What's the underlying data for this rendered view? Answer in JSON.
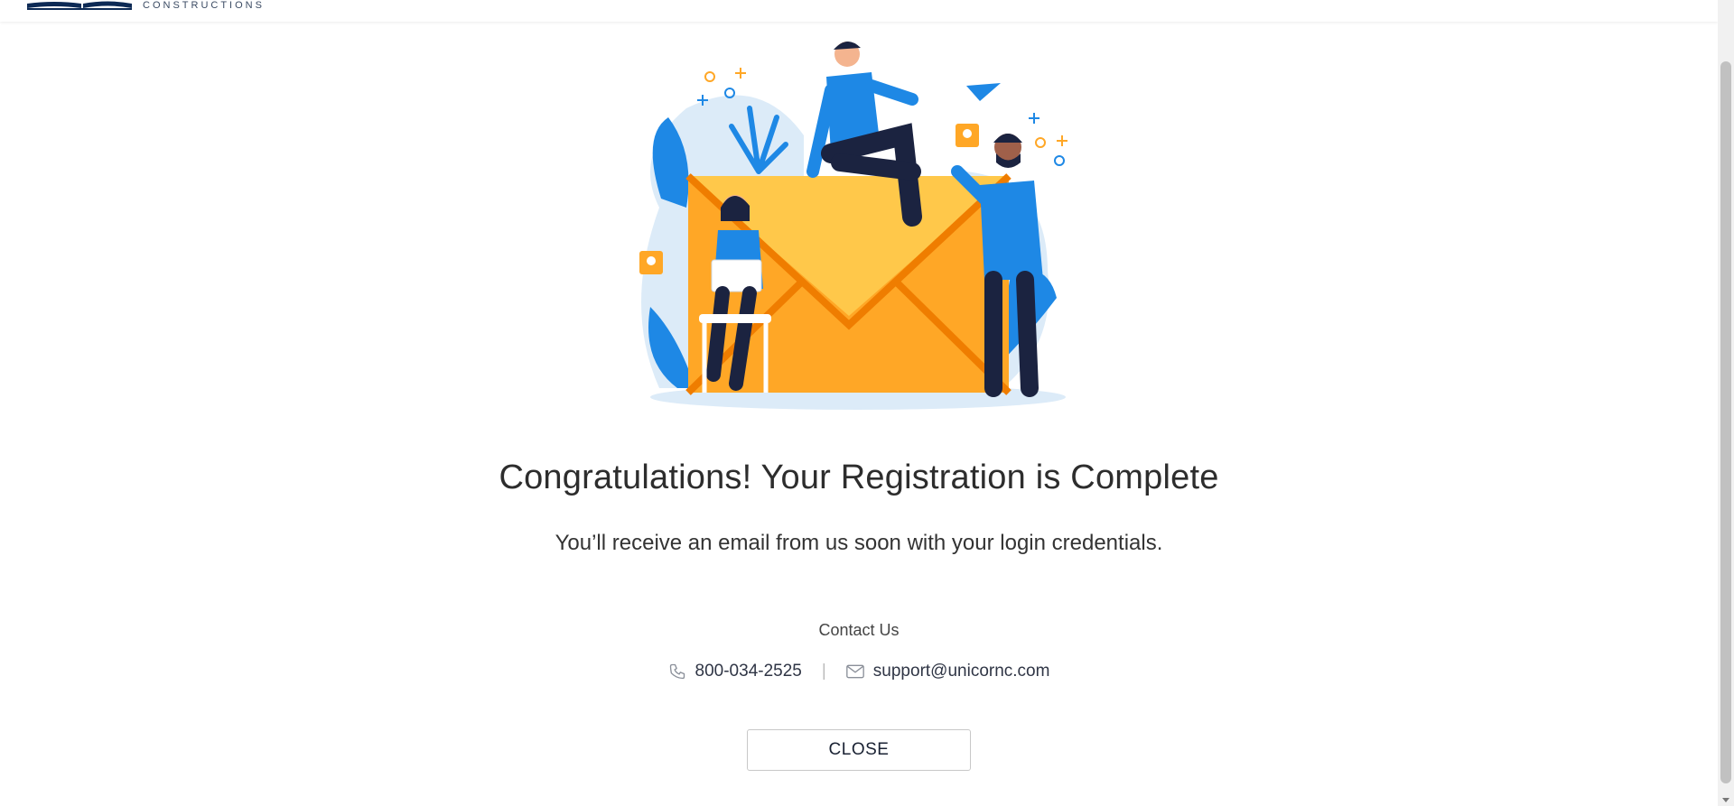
{
  "header": {
    "logo_text": "CONSTRUCTIONS"
  },
  "main": {
    "title": "Congratulations! Your Registration is Complete",
    "subtitle": "You’ll receive an email from us soon with your login credentials."
  },
  "contact": {
    "heading": "Contact Us",
    "phone": "800-034-2525",
    "divider": "|",
    "email": "support@unicornc.com"
  },
  "actions": {
    "close_label": "CLOSE"
  },
  "colors": {
    "primary_blue": "#1e88e5",
    "envelope_orange": "#ffa726",
    "light_bg": "#dcebf8"
  }
}
